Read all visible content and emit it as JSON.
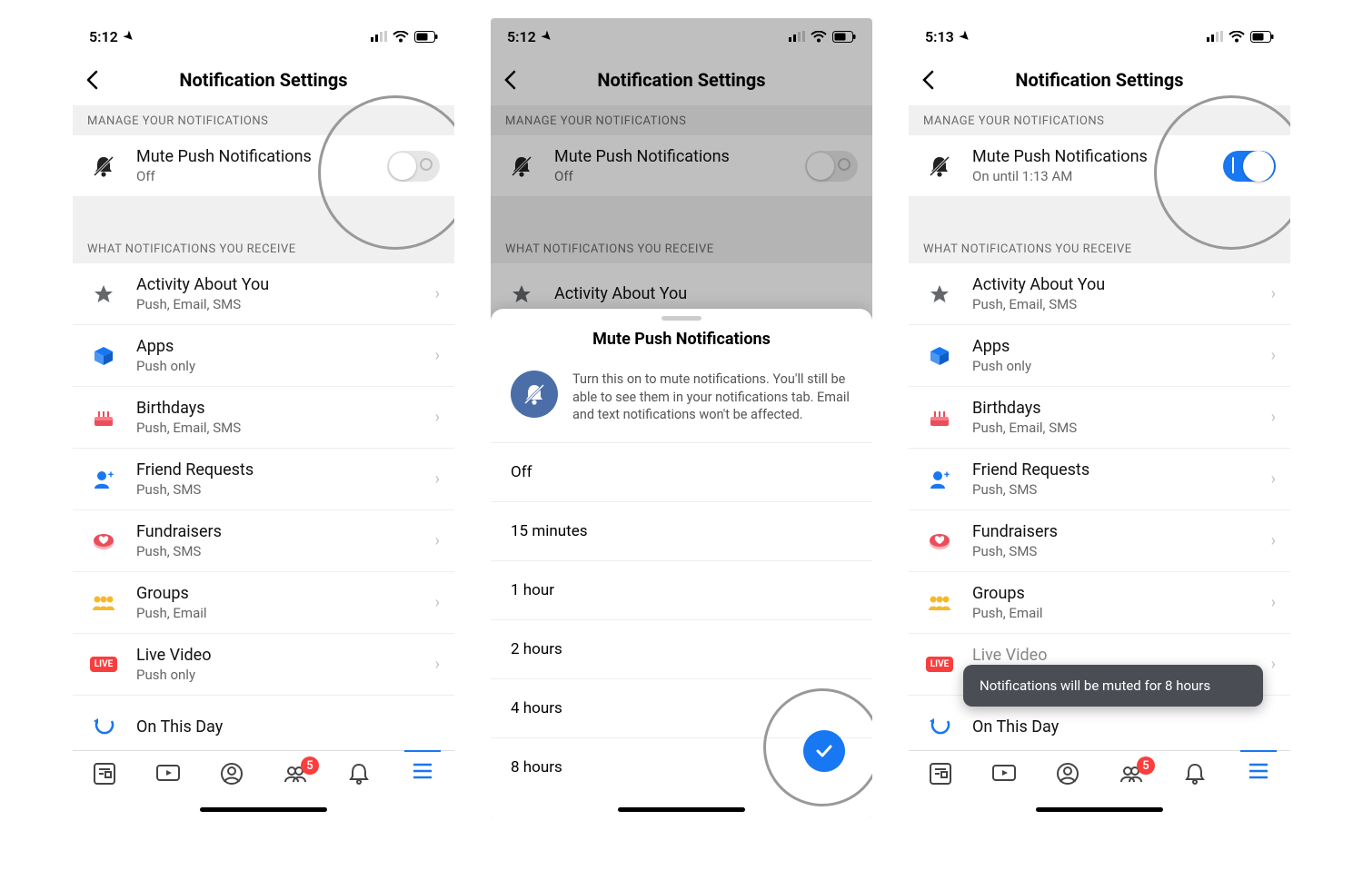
{
  "screens": [
    {
      "status": {
        "time": "5:12",
        "location_arrow": true
      },
      "header": {
        "title": "Notification Settings"
      },
      "sections": {
        "manage_label": "MANAGE YOUR NOTIFICATIONS",
        "mute": {
          "title": "Mute Push Notifications",
          "sub": "Off",
          "toggle_on": false
        },
        "receive_label": "WHAT NOTIFICATIONS YOU RECEIVE",
        "items": [
          {
            "title": "Activity About You",
            "sub": "Push, Email, SMS",
            "icon": "star"
          },
          {
            "title": "Apps",
            "sub": "Push only",
            "icon": "box"
          },
          {
            "title": "Birthdays",
            "sub": "Push, Email, SMS",
            "icon": "cake"
          },
          {
            "title": "Friend Requests",
            "sub": "Push, SMS",
            "icon": "friend"
          },
          {
            "title": "Fundraisers",
            "sub": "Push, SMS",
            "icon": "heart"
          },
          {
            "title": "Groups",
            "sub": "Push, Email",
            "icon": "group"
          },
          {
            "title": "Live Video",
            "sub": "Push only",
            "icon": "live"
          },
          {
            "title": "On This Day",
            "sub": "",
            "icon": "memory"
          }
        ]
      },
      "tabbar": {
        "badge": "5",
        "active": "menu"
      }
    },
    {
      "status": {
        "time": "5:12",
        "location_arrow": true
      },
      "header": {
        "title": "Notification Settings"
      },
      "sections_bg": {
        "manage_label": "MANAGE YOUR NOTIFICATIONS",
        "mute": {
          "title": "Mute Push Notifications",
          "sub": "Off"
        },
        "receive_label": "WHAT NOTIFICATIONS YOU RECEIVE",
        "item0": {
          "title": "Activity About You"
        }
      },
      "sheet": {
        "title": "Mute Push Notifications",
        "info": "Turn this on to mute notifications. You'll still be able to see them in your notifications tab. Email and text notifications won't be affected.",
        "options": [
          "Off",
          "15 minutes",
          "1 hour",
          "2 hours",
          "4 hours",
          "8 hours"
        ]
      }
    },
    {
      "status": {
        "time": "5:13",
        "location_arrow": true
      },
      "header": {
        "title": "Notification Settings"
      },
      "sections": {
        "manage_label": "MANAGE YOUR NOTIFICATIONS",
        "mute": {
          "title": "Mute Push Notifications",
          "sub": "On until 1:13 AM",
          "toggle_on": true
        },
        "receive_label": "WHAT NOTIFICATIONS YOU RECEIVE",
        "items": [
          {
            "title": "Activity About You",
            "sub": "Push, Email, SMS",
            "icon": "star"
          },
          {
            "title": "Apps",
            "sub": "Push only",
            "icon": "box"
          },
          {
            "title": "Birthdays",
            "sub": "Push, Email, SMS",
            "icon": "cake"
          },
          {
            "title": "Friend Requests",
            "sub": "Push, SMS",
            "icon": "friend"
          },
          {
            "title": "Fundraisers",
            "sub": "Push, SMS",
            "icon": "heart"
          },
          {
            "title": "Groups",
            "sub": "Push, Email",
            "icon": "group"
          },
          {
            "title": "Live Video",
            "sub": "Push only",
            "icon": "live"
          },
          {
            "title": "On This Day",
            "sub": "",
            "icon": "memory"
          }
        ]
      },
      "toast": "Notifications will be muted for 8 hours",
      "tabbar": {
        "badge": "5",
        "active": "menu"
      }
    }
  ],
  "icons_colors": {
    "star": "#65676b",
    "box": "#1877f2",
    "cake": "#e94e5a",
    "friend": "#1877f2",
    "heart": "#e94e5a",
    "group": "#f7b928",
    "live": "#fa3e3e",
    "memory": "#1877f2"
  }
}
